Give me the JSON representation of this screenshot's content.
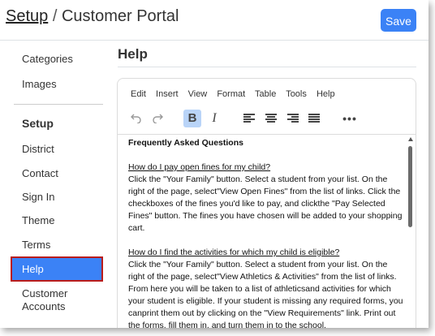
{
  "header": {
    "breadcrumb_link": "Setup",
    "separator": "/",
    "page_name": "Customer Portal",
    "save_label": "Save"
  },
  "sidebar": {
    "items_top": [
      "Categories",
      "Images"
    ],
    "section_heading": "Setup",
    "items": [
      "District",
      "Contact",
      "Sign In",
      "Theme",
      "Terms"
    ],
    "active_item": "Help",
    "last_item_line1": "Customer",
    "last_item_line2": "Accounts"
  },
  "main": {
    "title": "Help"
  },
  "editor": {
    "menu": [
      "Edit",
      "Insert",
      "View",
      "Format",
      "Table",
      "Tools",
      "Help"
    ],
    "toolbar_icons": [
      "undo-icon",
      "redo-icon",
      "bold-icon",
      "italic-icon",
      "align-left-icon",
      "align-center-icon",
      "align-right-icon",
      "align-justify-icon",
      "more-icon"
    ],
    "bold_glyph": "B",
    "italic_glyph": "I",
    "more_glyph": "•••",
    "content": {
      "heading": "Frequently Asked Questions",
      "q1": "How do I pay open fines for my child?",
      "a1": "Click the \"Your Family\" button. Select a student from your list. On the right of the page, select\"View Open Fines\" from the list of links. Click the checkboxes of the fines you'd like to pay, and clickthe \"Pay Selected Fines\" button. The fines you have chosen will be added to your shopping cart.",
      "q2": "How do I find the activities for which my child is eligible?",
      "a2": "Click the \"Your Family\" button. Select a student from your list. On the right of the page, select\"View Athletics & Activities\" from the list of links. From here you will be taken to a list of athleticsand activities for which your student is eligible. If your student is missing any required forms, you canprint them out by clicking on the \"View Requirements\" link. Print out the forms, fill them in, and turn them in to the school."
    }
  },
  "colors": {
    "accent": "#3b82f6",
    "active_border": "#b91c1c",
    "bold_active": "#b9d4f8"
  }
}
